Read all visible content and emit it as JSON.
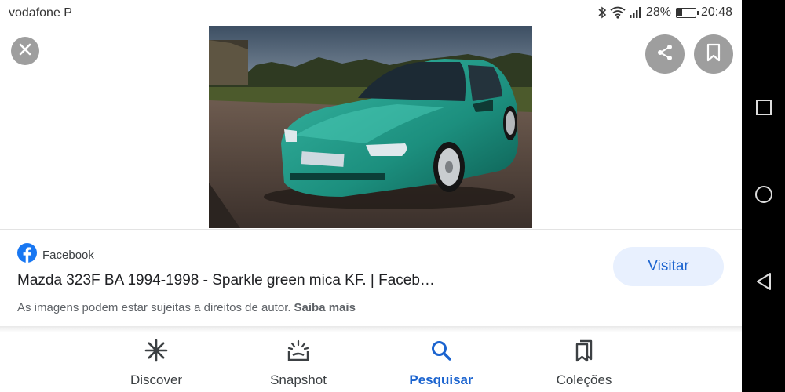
{
  "status_bar": {
    "carrier": "vodafone P",
    "battery_percent": "28%",
    "battery_level": 0.28,
    "time": "20:48"
  },
  "viewer": {
    "close_icon": "close-icon",
    "share_icon": "share-icon",
    "bookmark_icon": "bookmark-icon",
    "image_subject": "green hatchback car photo"
  },
  "result": {
    "source_name": "Facebook",
    "source_icon": "facebook-icon",
    "title": "Mazda 323F BA 1994-1998 - Sparkle green mica KF. | Faceb…",
    "copyright_text": "As imagens podem estar sujeitas a direitos de autor.",
    "learn_more": "Saiba mais",
    "visit_label": "Visitar"
  },
  "bottom_nav": {
    "tabs": [
      {
        "label": "Discover",
        "icon": "asterisk-icon"
      },
      {
        "label": "Snapshot",
        "icon": "snapshot-icon"
      },
      {
        "label": "Pesquisar",
        "icon": "search-icon",
        "active": true
      },
      {
        "label": "Coleções",
        "icon": "collections-icon"
      }
    ]
  },
  "colors": {
    "accent": "#1a63cf",
    "visit_bg": "#e8f0fe",
    "facebook_blue": "#1877f2",
    "car_green": "#1f9a87"
  }
}
